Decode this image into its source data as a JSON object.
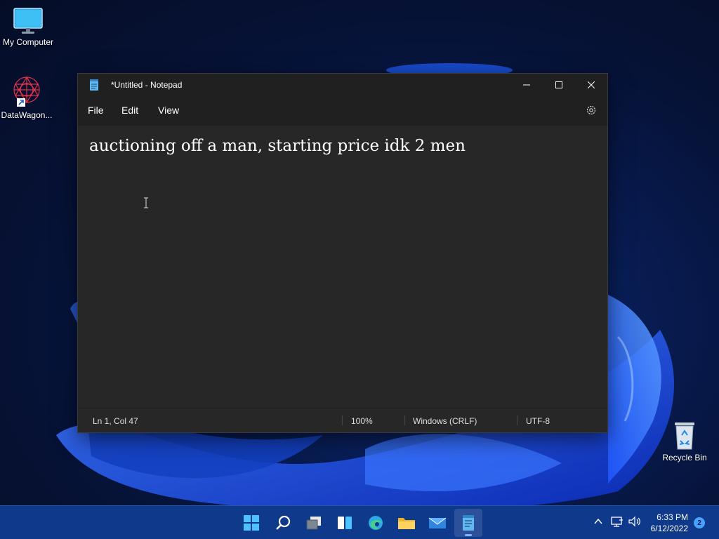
{
  "desktop": {
    "icons": [
      {
        "label": "My Computer",
        "icon": "monitor-icon"
      },
      {
        "label": "DataWagon...",
        "icon": "datawagon-shortcut-icon"
      },
      {
        "label": "Recycle Bin",
        "icon": "recycle-bin-icon"
      }
    ]
  },
  "notepad": {
    "title": "*Untitled - Notepad",
    "menu": {
      "file": "File",
      "edit": "Edit",
      "view": "View"
    },
    "content": "auctioning off a man, starting price idk 2 men",
    "status": {
      "position": "Ln 1, Col 47",
      "zoom": "100%",
      "line_ending": "Windows (CRLF)",
      "encoding": "UTF-8"
    }
  },
  "taskbar": {
    "apps": [
      "start-icon",
      "search-icon",
      "task-view-icon",
      "widgets-icon",
      "edge-icon",
      "file-explorer-icon",
      "mail-icon",
      "notepad-icon"
    ],
    "active_app": "notepad-icon",
    "clock": {
      "time": "6:33 PM",
      "date": "6/12/2022"
    },
    "notification_count": "2"
  },
  "colors": {
    "window_bg": "#272727",
    "titlebar_bg": "#202020",
    "taskbar_bg": "#0f3a8c",
    "accent": "#4aa0ff"
  }
}
